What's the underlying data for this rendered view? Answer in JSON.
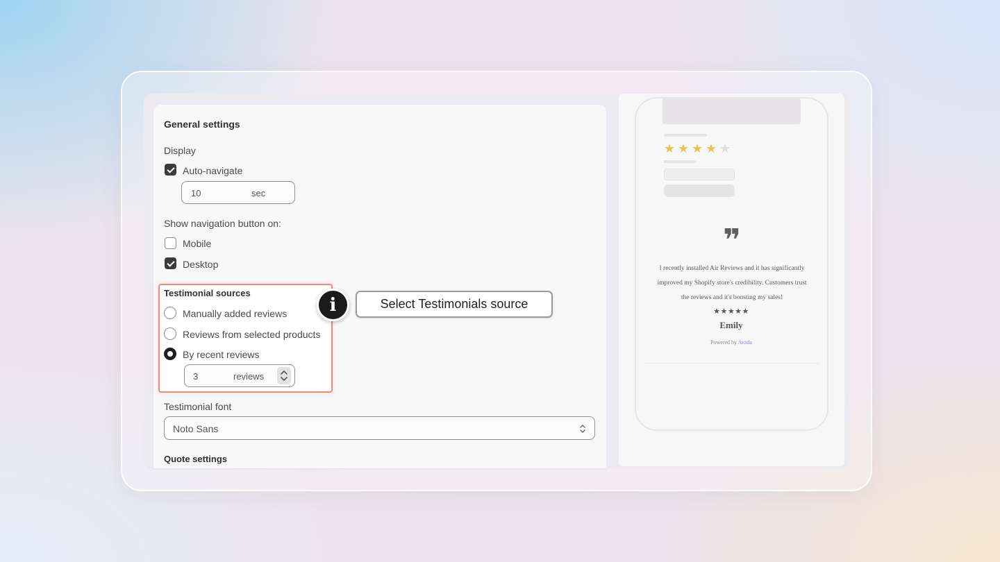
{
  "settings": {
    "title": "General settings",
    "display_label": "Display",
    "auto_navigate": {
      "label": "Auto-navigate",
      "checked": true,
      "value": "10",
      "unit": "sec"
    },
    "nav_button_label": "Show navigation button on:",
    "nav_options": [
      {
        "label": "Mobile",
        "checked": false
      },
      {
        "label": "Desktop",
        "checked": true
      }
    ],
    "sources": {
      "label": "Testimonial sources",
      "options": [
        {
          "label": "Manually added reviews",
          "selected": false
        },
        {
          "label": "Reviews from selected products",
          "selected": false
        },
        {
          "label": "By recent reviews",
          "selected": true
        }
      ],
      "count_value": "3",
      "count_unit": "reviews"
    },
    "font": {
      "label": "Testimonial font",
      "value": "Noto Sans"
    },
    "quote_settings_label": "Quote settings"
  },
  "callout": {
    "icon": "info-icon",
    "icon_glyph": "i",
    "text": "Select Testimonials source"
  },
  "preview": {
    "rating": 4,
    "quote_icon": "quote-mark-icon",
    "quote_glyph": "❞",
    "testimonial_text": "I recently installed Air Reviews and it has significantly improved my Shopify store's credibility. Customers trust the reviews and it's boosting my sales!",
    "testimonial_stars": "★★★★★",
    "author": "Emily",
    "powered_prefix": "Powered by",
    "powered_brand": "Avada"
  },
  "colors": {
    "highlight_border": "#ee8a7c",
    "star_filled": "#e6c453",
    "checkbox_checked": "#3b3b3b"
  }
}
